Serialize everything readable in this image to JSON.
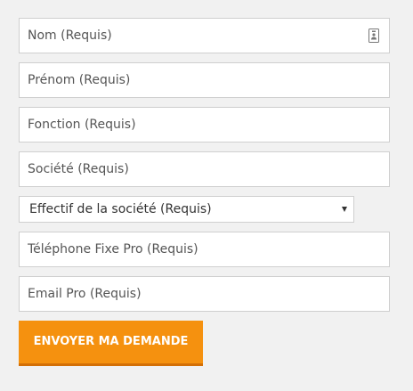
{
  "form": {
    "fields": {
      "nom": {
        "value": "",
        "placeholder": "Nom (Requis)"
      },
      "prenom": {
        "value": "",
        "placeholder": "Prénom (Requis)"
      },
      "fonction": {
        "value": "",
        "placeholder": "Fonction (Requis)"
      },
      "societe": {
        "value": "",
        "placeholder": "Société (Requis)"
      },
      "telephone": {
        "value": "",
        "placeholder": "Téléphone Fixe Pro (Requis)"
      },
      "email": {
        "value": "",
        "placeholder": "Email Pro (Requis)"
      }
    },
    "effectif": {
      "selected": "Effectif de la société (Requis)"
    },
    "submit_label": "ENVOYER MA DEMANDE",
    "autofill_icon": "contact-card-icon"
  },
  "colors": {
    "page_background": "#f1f1f1",
    "field_border": "#cfcfcf",
    "text": "#555555",
    "button_background": "#f5910f",
    "button_shadow": "#d36f06",
    "button_text": "#ffffff"
  }
}
